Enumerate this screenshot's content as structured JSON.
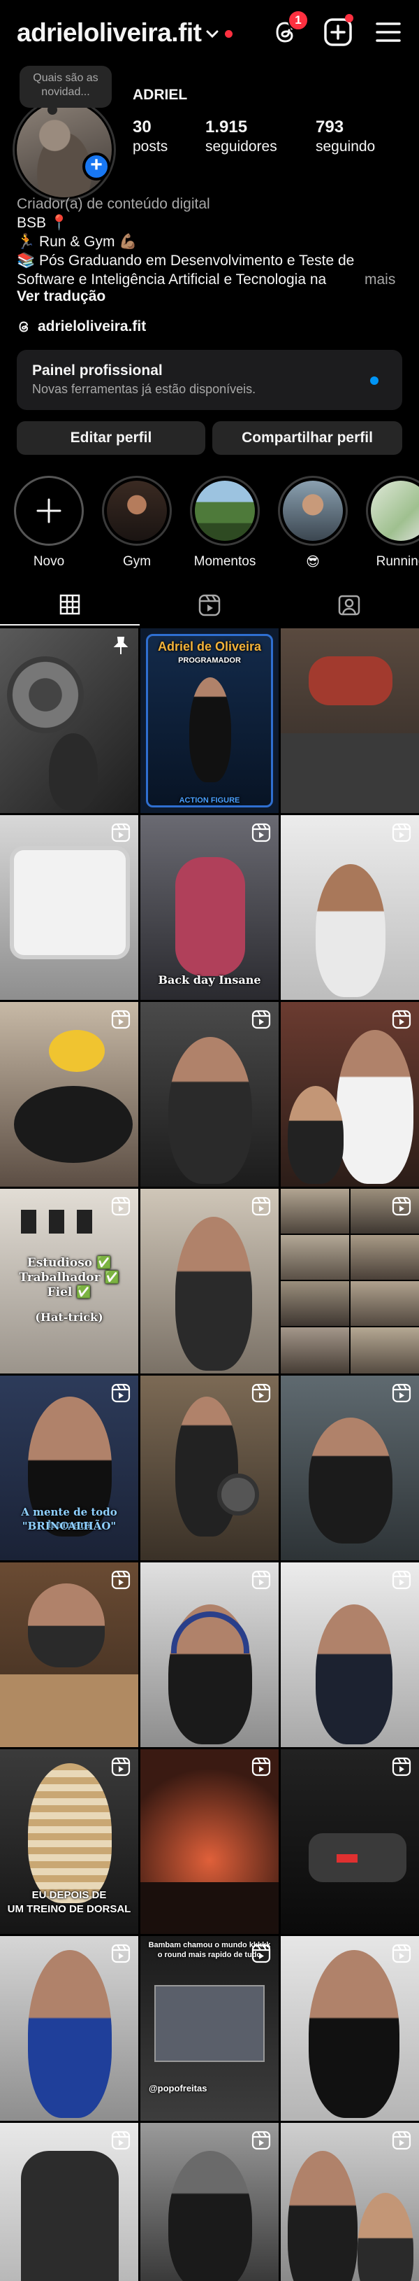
{
  "header": {
    "username": "adrieloliveira.fit",
    "threads_badge": "1"
  },
  "profile": {
    "note": "Quais são as novidad...",
    "display_name": "ADRIEL",
    "stats": [
      {
        "value": "30",
        "label": "posts"
      },
      {
        "value": "1.915",
        "label": "seguidores"
      },
      {
        "value": "793",
        "label": "seguindo"
      }
    ],
    "category": "Criador(a) de conteúdo digital",
    "bio_lines": [
      "BSB 📍",
      "🏃 Run & Gym 💪🏽",
      "📚 Pós Graduando em Desenvolvimento e Teste de",
      "Software e Inteligência Artificial e Tecnologia na"
    ],
    "more": "mais",
    "translate": "Ver tradução",
    "link": "adrieloliveira.fit"
  },
  "pro_panel": {
    "title": "Painel profissional",
    "subtitle": "Novas ferramentas já estão disponíveis."
  },
  "buttons": {
    "edit": "Editar perfil",
    "share": "Compartilhar perfil"
  },
  "highlights": [
    {
      "label": "Novo"
    },
    {
      "label": "Gym"
    },
    {
      "label": "Momentos"
    },
    {
      "label": "😎"
    },
    {
      "label": "Running"
    }
  ],
  "posts": {
    "p1_title": "Adriel de Oliveira",
    "p1_sub": "PROGRAMADOR",
    "p1_footer": "ACTION FIGURE",
    "p2": "Back day Insane",
    "p3": [
      "Estudioso ✅",
      "Trabalhador ✅",
      "Fiel ✅",
      "(Hat-trick)"
    ],
    "p4": [
      "A mente de todo homem",
      "\"BRINCALHÃO\""
    ],
    "p5": [
      "EU DEPOIS DE",
      "UM TREINO DE DORSAL"
    ],
    "p6": "Bambam chamou o mundo kkkkk o round mais rapido de tudo",
    "p6_handle": "@popofreitas"
  },
  "colors": {
    "accent": "#0095f6",
    "badge": "#ff3040",
    "button_bg": "#262626"
  }
}
